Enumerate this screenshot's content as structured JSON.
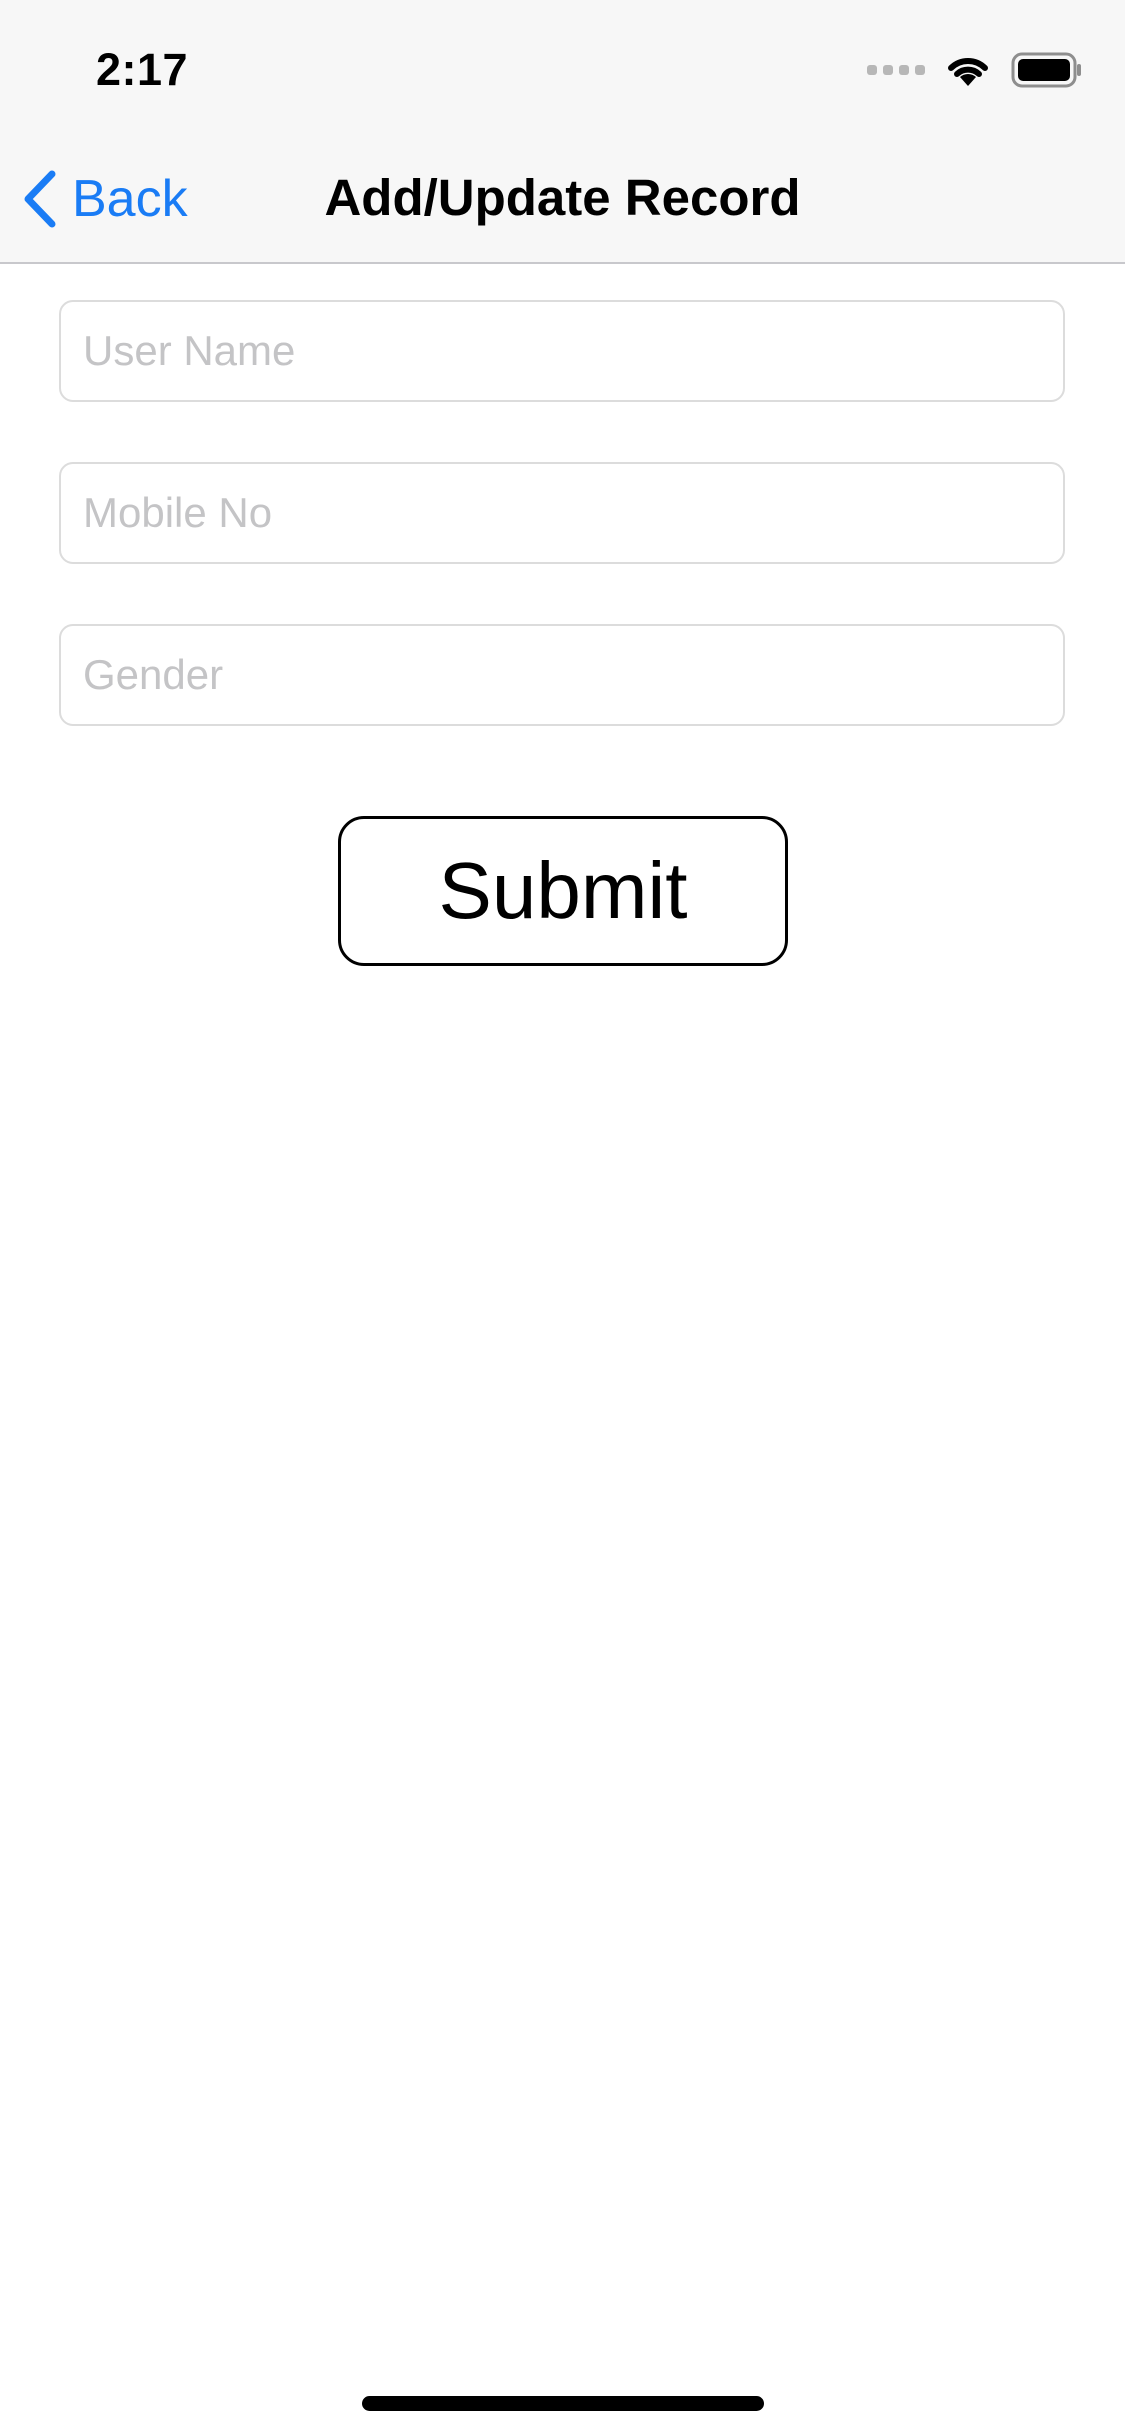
{
  "status_bar": {
    "time": "2:17"
  },
  "icons": {
    "signal": "cellular-signal-icon",
    "wifi": "wifi-icon",
    "battery": "battery-icon",
    "back": "chevron-left-icon"
  },
  "nav": {
    "back_label": "Back",
    "title": "Add/Update Record"
  },
  "form": {
    "user_name": {
      "value": "",
      "placeholder": "User Name"
    },
    "mobile_no": {
      "value": "",
      "placeholder": "Mobile No"
    },
    "gender": {
      "value": "",
      "placeholder": "Gender"
    },
    "submit_label": "Submit"
  },
  "colors": {
    "accent": "#1a7cf5",
    "nav_background": "#f7f7f7",
    "field_border": "#dcdcdc",
    "placeholder": "#c4c4c6"
  }
}
